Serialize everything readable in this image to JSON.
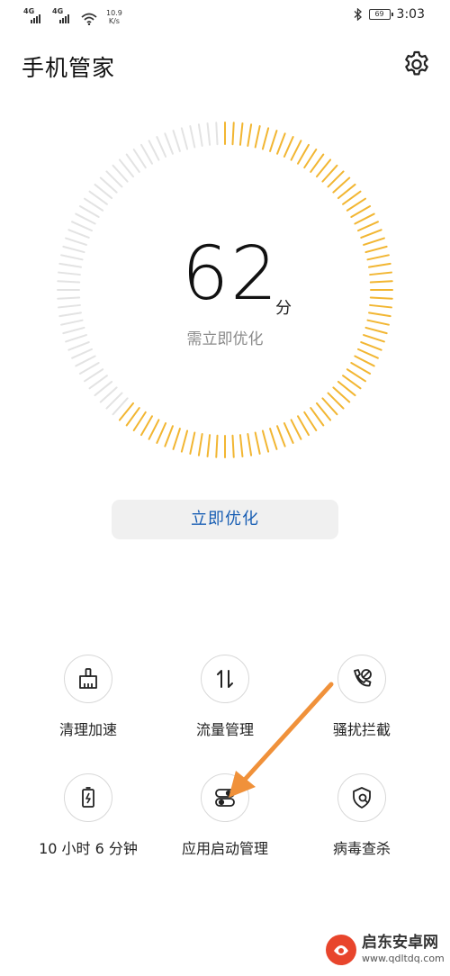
{
  "status_bar": {
    "signal1_tag": "4G",
    "signal2_tag": "4G",
    "speed_value": "10.9",
    "speed_unit": "K/s",
    "battery": "69",
    "time": "3:03"
  },
  "header": {
    "title": "手机管家",
    "settings_icon": "gear-icon"
  },
  "score": {
    "value": "62",
    "unit": "分",
    "status": "需立即优化",
    "progress": 0.62,
    "accent_color": "#f2b632",
    "inactive_color": "#e3e3e3"
  },
  "optimize_button": {
    "label": "立即优化",
    "color": "#1a5fb4"
  },
  "tools": [
    {
      "label": "清理加速",
      "icon": "broom-icon"
    },
    {
      "label": "流量管理",
      "icon": "data-traffic-icon"
    },
    {
      "label": "骚扰拦截",
      "icon": "phone-block-icon"
    },
    {
      "label": "10 小时 6 分钟",
      "icon": "battery-icon"
    },
    {
      "label": "应用启动管理",
      "icon": "app-launch-icon"
    },
    {
      "label": "病毒查杀",
      "icon": "virus-scan-icon"
    }
  ],
  "annotation_arrow_color": "#f0913a",
  "watermark": {
    "text": "启东安卓网",
    "url": "www.qdltdq.com"
  }
}
